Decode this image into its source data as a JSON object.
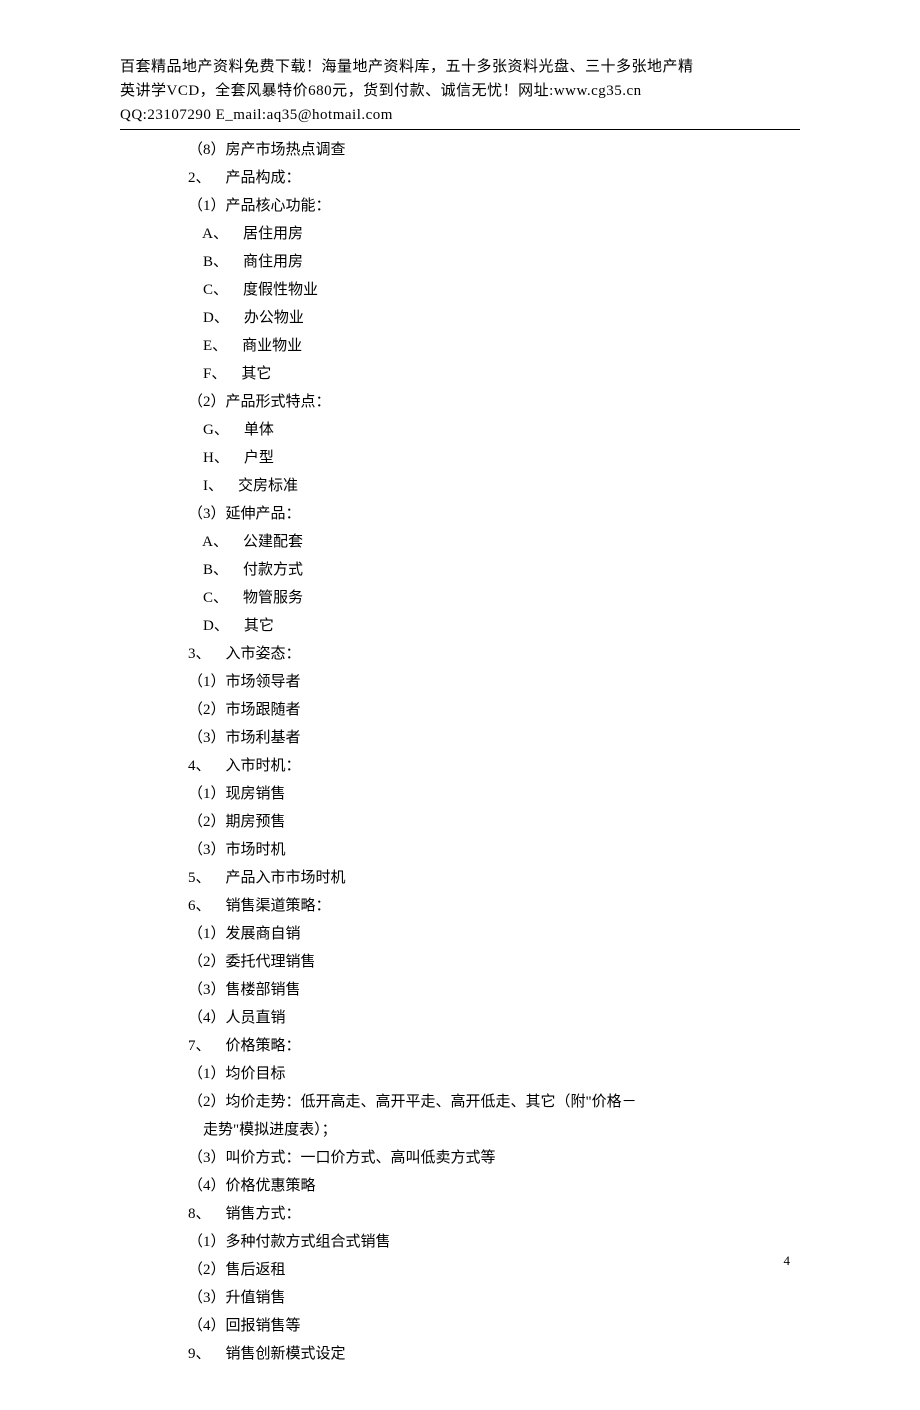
{
  "header": {
    "line1": "百套精品地产资料免费下载！海量地产资料库，五十多张资料光盘、三十多张地产精",
    "line2": "英讲学VCD，全套风暴特价680元，货到付款、诚信无忧！网址:www.cg35.cn",
    "line3": "QQ:23107290  E_mail:aq35@hotmail.com"
  },
  "content": {
    "lines": [
      "（8）房产市场热点调查",
      "2、    产品构成：",
      "（1）产品核心功能：",
      "    A、    居住用房",
      "    B、    商住用房",
      "    C、    度假性物业",
      "    D、    办公物业",
      "    E、    商业物业",
      "    F、    其它",
      "（2）产品形式特点：",
      "    G、    单体",
      "    H、    户型",
      "    I、    交房标准",
      "（3）延伸产品：",
      "    A、    公建配套",
      "    B、    付款方式",
      "    C、    物管服务",
      "    D、    其它",
      "3、    入市姿态：",
      "（1）市场领导者",
      "（2）市场跟随者",
      "（3）市场利基者",
      "4、    入市时机：",
      "（1）现房销售",
      "（2）期房预售",
      "（3）市场时机",
      "5、    产品入市市场时机",
      "",
      "6、    销售渠道策略：",
      "（1）发展商自销",
      "（2）委托代理销售",
      "（3）售楼部销售",
      "（4）人员直销",
      "7、    价格策略：",
      "（1）均价目标",
      "（2）均价走势：低开高走、高开平走、高开低走、其它（附\"价格－",
      "    走势\"模拟进度表）；",
      "（3）叫价方式：一口价方式、高叫低卖方式等",
      "（4）价格优惠策略",
      "8、    销售方式：",
      "（1）多种付款方式组合式销售",
      "（2）售后返租",
      "（3）升值销售",
      "（4）回报销售等",
      "9、    销售创新模式设定"
    ]
  },
  "pageNumber": "4"
}
